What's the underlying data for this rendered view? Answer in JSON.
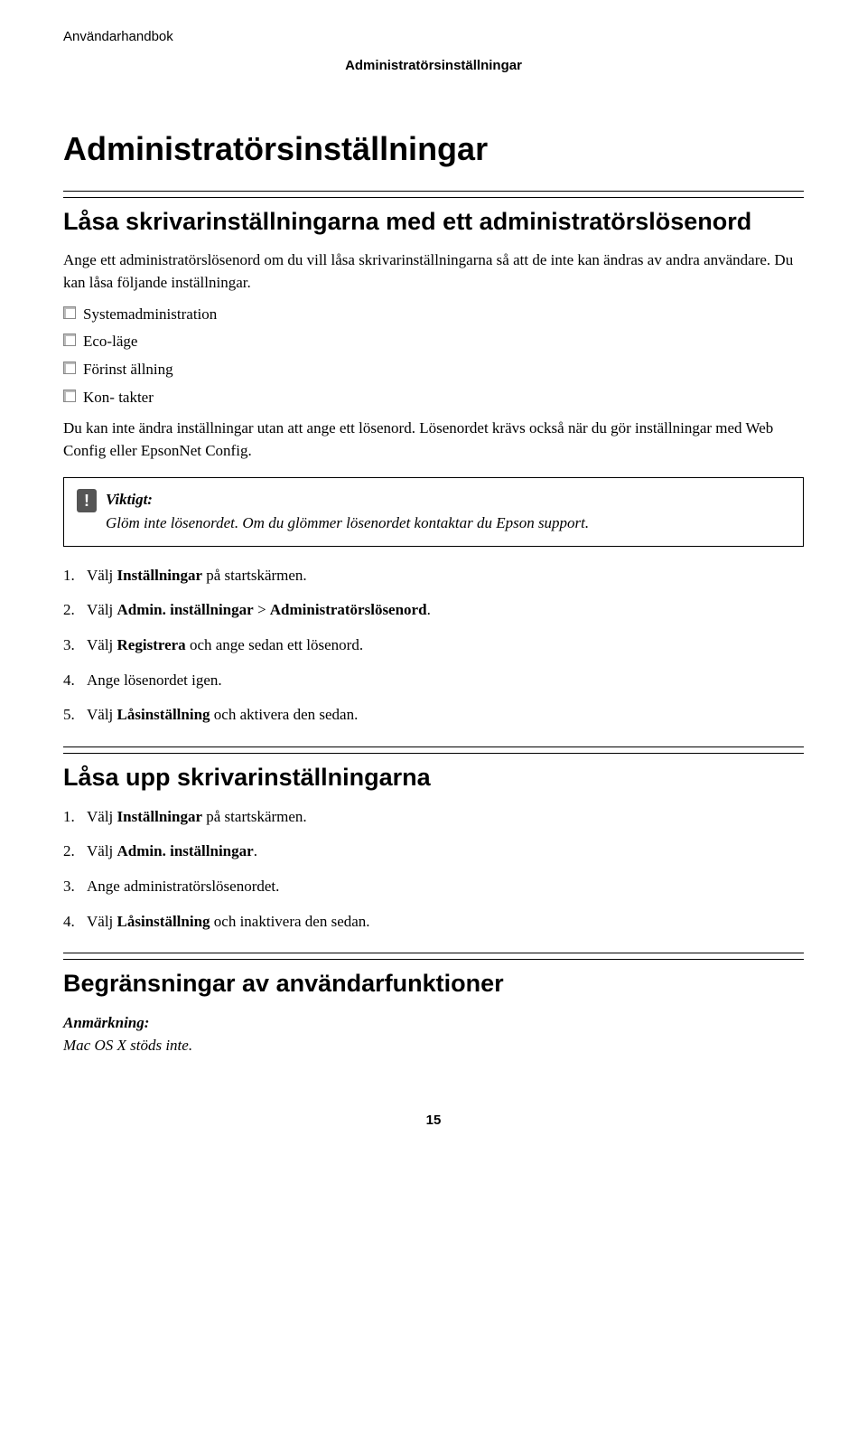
{
  "header": {
    "left": "Användarhandbok",
    "center": "Administratörsinställningar"
  },
  "title": "Administratörsinställningar",
  "section1": {
    "heading": "Låsa skrivarinställningarna med ett administratörslösenord",
    "intro": "Ange ett administratörslösenord om du vill låsa skrivarinställningarna så att de inte kan ändras av andra användare. Du kan låsa följande inställningar.",
    "bullets": [
      "Systemadministration",
      "Eco-läge",
      "Förinst ällning",
      "Kon- takter"
    ],
    "after_bullets": "Du kan inte ändra inställningar utan att ange ett lösenord. Lösenordet krävs också när du gör inställningar med Web Config eller EpsonNet Config.",
    "callout": {
      "label": "Viktigt:",
      "body": "Glöm inte lösenordet. Om du glömmer lösenordet kontaktar du Epson support."
    },
    "steps": [
      {
        "pre": "Välj ",
        "b": "Inställningar",
        "post": " på startskärmen."
      },
      {
        "pre": "Välj ",
        "b": "Admin. inställningar",
        "mid": " > ",
        "b2": "Administratörslösenord",
        "post": "."
      },
      {
        "pre": "Välj ",
        "b": "Registrera",
        "post": " och ange sedan ett lösenord."
      },
      {
        "pre": "Ange lösenordet igen.",
        "b": "",
        "post": ""
      },
      {
        "pre": "Välj ",
        "b": "Låsinställning",
        "post": " och aktivera den sedan."
      }
    ]
  },
  "section2": {
    "heading": "Låsa upp skrivarinställningarna",
    "steps": [
      {
        "pre": "Välj ",
        "b": "Inställningar",
        "post": " på startskärmen."
      },
      {
        "pre": "Välj ",
        "b": "Admin. inställningar",
        "post": "."
      },
      {
        "pre": "Ange administratörslösenordet.",
        "b": "",
        "post": ""
      },
      {
        "pre": "Välj ",
        "b": "Låsinställning",
        "post": " och inaktivera den sedan."
      }
    ]
  },
  "section3": {
    "heading": "Begränsningar av användarfunktioner",
    "note_label": "Anmärkning:",
    "note_body": "Mac OS X stöds inte."
  },
  "page_number": "15"
}
